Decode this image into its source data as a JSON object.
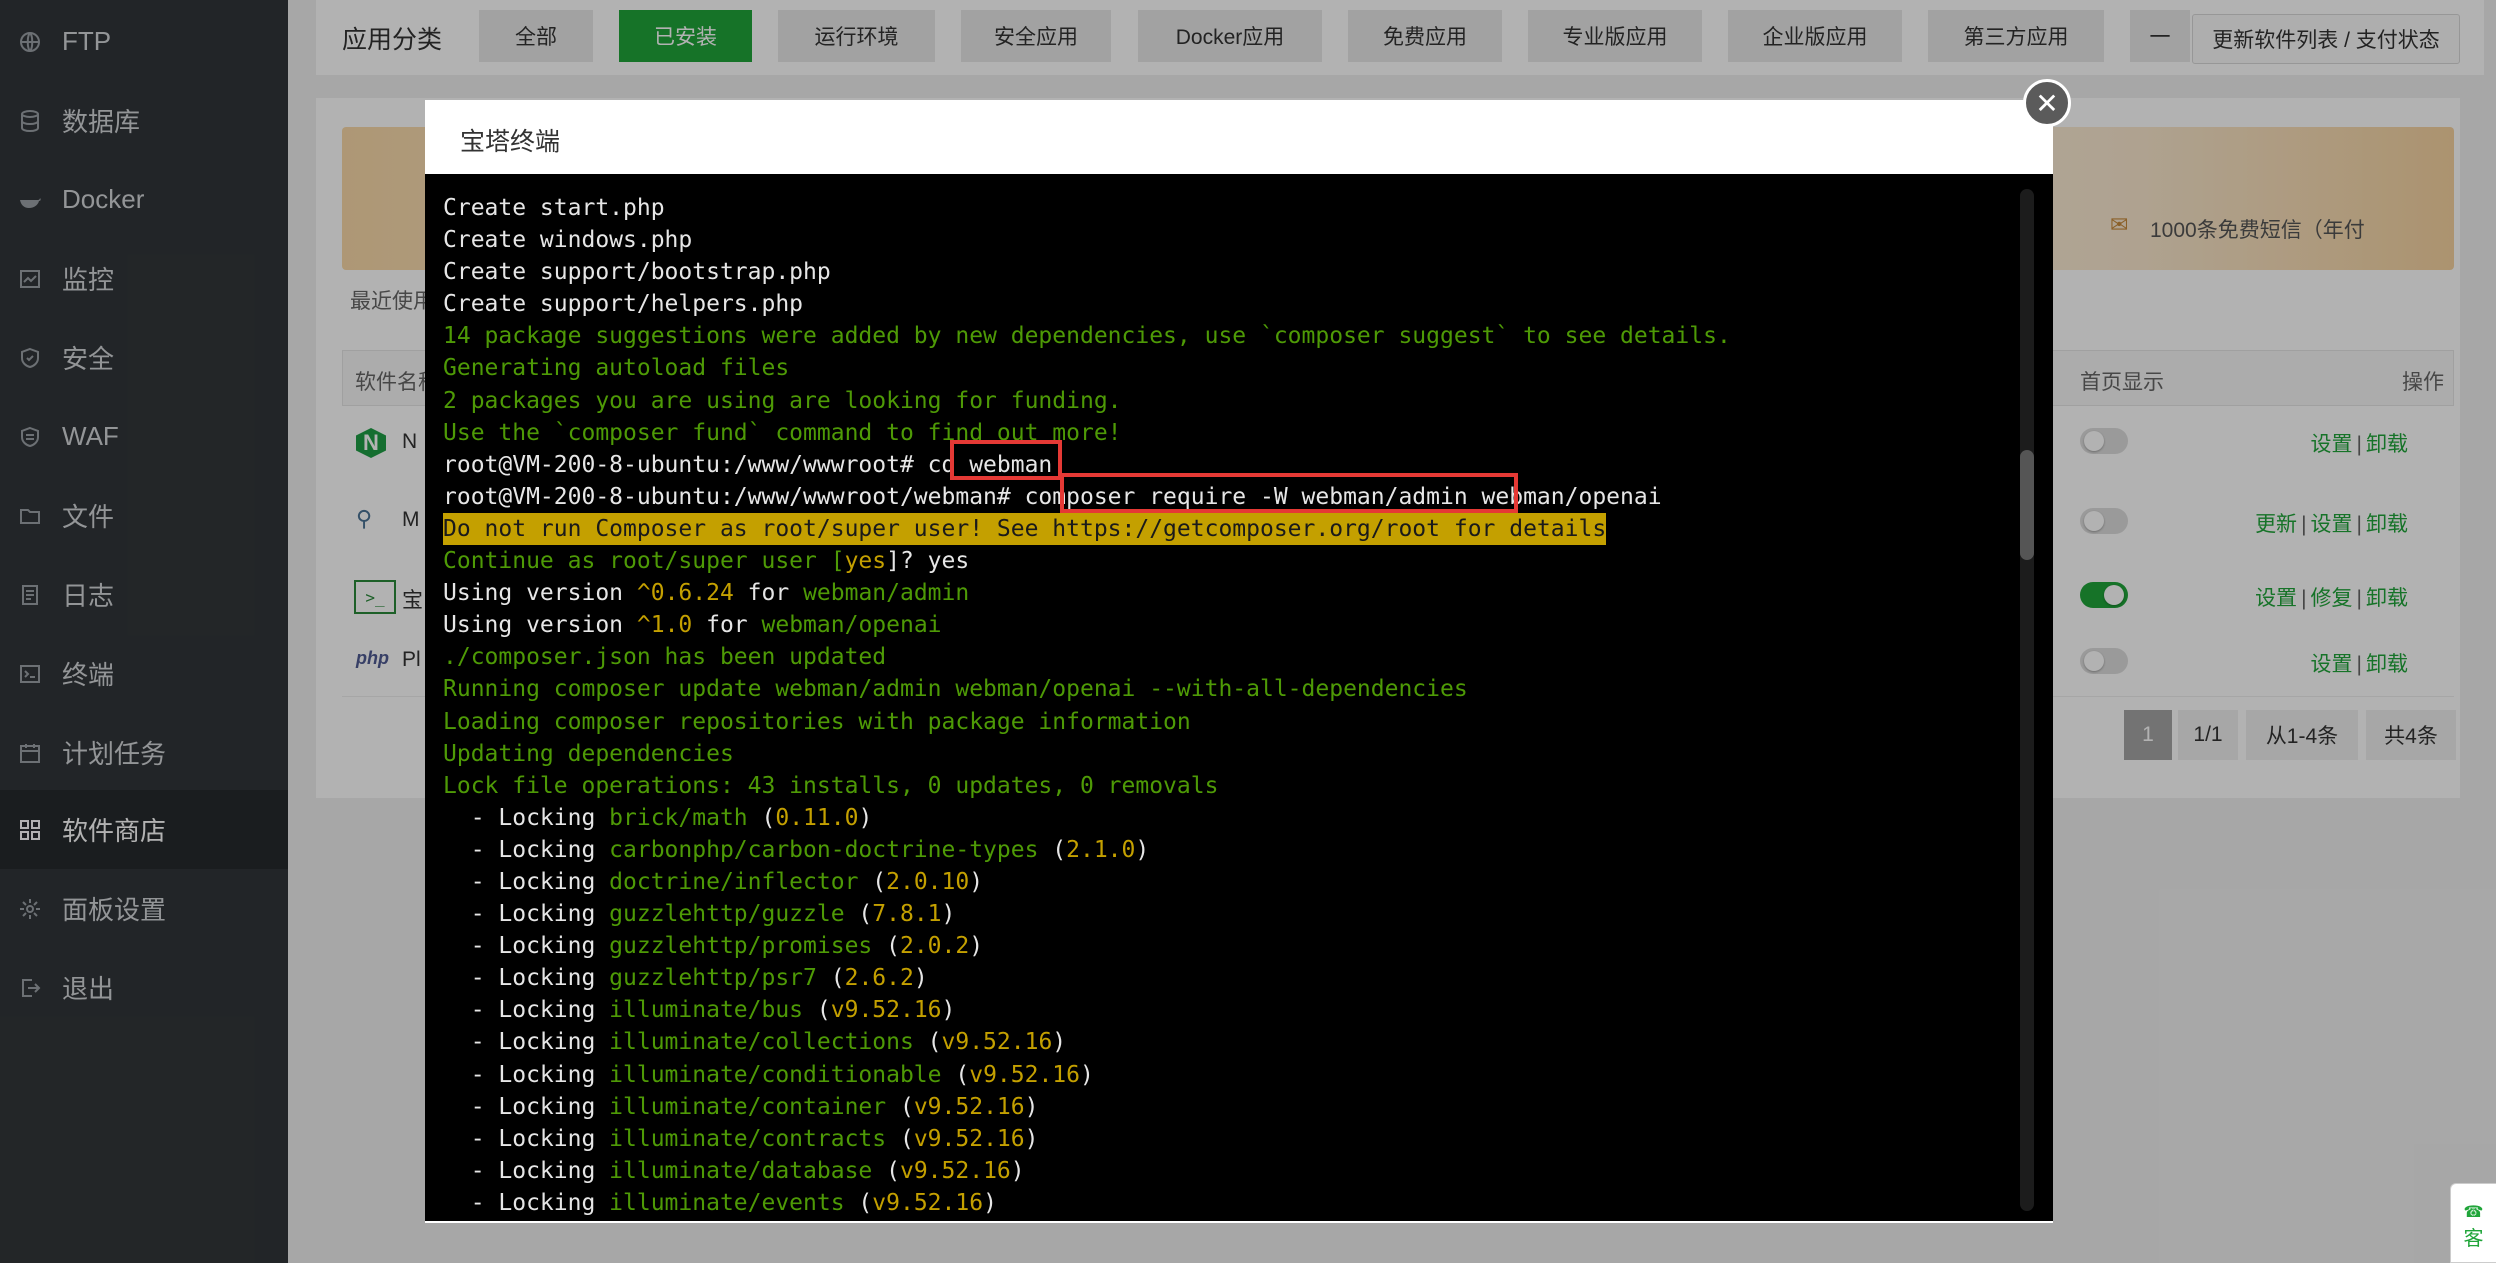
{
  "sidebar": {
    "items": [
      {
        "label": "FTP",
        "icon": "globe-icon"
      },
      {
        "label": "数据库",
        "icon": "database-icon"
      },
      {
        "label": "Docker",
        "icon": "docker-icon"
      },
      {
        "label": "监控",
        "icon": "monitor-icon"
      },
      {
        "label": "安全",
        "icon": "shield-icon"
      },
      {
        "label": "WAF",
        "icon": "waf-shield-icon"
      },
      {
        "label": "文件",
        "icon": "folder-icon"
      },
      {
        "label": "日志",
        "icon": "log-icon"
      },
      {
        "label": "终端",
        "icon": "terminal-icon"
      },
      {
        "label": "计划任务",
        "icon": "calendar-icon"
      },
      {
        "label": "软件商店",
        "icon": "apps-icon",
        "active": true
      },
      {
        "label": "面板设置",
        "icon": "gear-icon"
      },
      {
        "label": "退出",
        "icon": "logout-icon"
      }
    ]
  },
  "store": {
    "category_title": "应用分类",
    "categories": [
      "全部",
      "已安装",
      "运行环境",
      "安全应用",
      "Docker应用",
      "免费应用",
      "专业版应用",
      "企业版应用",
      "第三方应用",
      "一"
    ],
    "active_category": "已安装",
    "update_button": "更新软件列表 / 支付状态",
    "sms_promo": "1000条免费短信（年付",
    "recent_label": "最近使用",
    "table_headers": {
      "name": "软件名称",
      "home_display": "首页显示",
      "actions": "操作"
    },
    "rows": [
      {
        "icon_text": "N",
        "name_fragment": "N",
        "toggle": false,
        "actions": [
          "设置",
          "卸载"
        ]
      },
      {
        "icon_text": "⚲",
        "name_fragment": "M",
        "toggle": false,
        "actions": [
          "更新",
          "设置",
          "卸载"
        ]
      },
      {
        "icon_text": ">_",
        "name_fragment": "宝",
        "toggle": true,
        "actions": [
          "设置",
          "修复",
          "卸载"
        ]
      },
      {
        "icon_text": "php",
        "name_fragment": "Pl",
        "toggle": false,
        "actions": [
          "设置",
          "卸载"
        ]
      }
    ],
    "pager": {
      "current": "1",
      "pages": "1/1",
      "range": "从1-4条",
      "total": "共4条"
    }
  },
  "modal": {
    "title": "宝塔终端",
    "close_symbol": "✕"
  },
  "terminal": {
    "lines": [
      [
        {
          "t": "Create start.php",
          "c": "w"
        }
      ],
      [
        {
          "t": "Create windows.php",
          "c": "w"
        }
      ],
      [
        {
          "t": "Create support/bootstrap.php",
          "c": "w"
        }
      ],
      [
        {
          "t": "Create support/helpers.php",
          "c": "w"
        }
      ],
      [
        {
          "t": "14 package suggestions were added by new dependencies, use `composer suggest` to see details.",
          "c": "g"
        }
      ],
      [
        {
          "t": "Generating autoload files",
          "c": "g"
        }
      ],
      [
        {
          "t": "2 packages you are using are looking for funding.",
          "c": "g"
        }
      ],
      [
        {
          "t": "Use the `composer fund` command to find out more!",
          "c": "g"
        }
      ],
      [
        {
          "t": "root@VM-200-8-ubuntu:/www/wwwroot# cd webman",
          "c": "w"
        }
      ],
      [
        {
          "t": "root@VM-200-8-ubuntu:/www/wwwroot/webman# composer require -W webman/admin webman/openai",
          "c": "w"
        }
      ],
      [
        {
          "t": "Do not run Composer as root/super user! See https://getcomposer.org/root for details",
          "c": "warn"
        }
      ],
      [
        {
          "t": "Continue as root/super user [",
          "c": "g"
        },
        {
          "t": "yes",
          "c": "y"
        },
        {
          "t": "]? yes",
          "c": "w"
        }
      ],
      [
        {
          "t": "Using version ",
          "c": "w"
        },
        {
          "t": "^0.6.24",
          "c": "y"
        },
        {
          "t": " for ",
          "c": "w"
        },
        {
          "t": "webman/admin",
          "c": "g"
        }
      ],
      [
        {
          "t": "Using version ",
          "c": "w"
        },
        {
          "t": "^1.0",
          "c": "y"
        },
        {
          "t": " for ",
          "c": "w"
        },
        {
          "t": "webman/openai",
          "c": "g"
        }
      ],
      [
        {
          "t": "./composer.json has been updated",
          "c": "g"
        }
      ],
      [
        {
          "t": "Running composer update webman/admin webman/openai --with-all-dependencies",
          "c": "g"
        }
      ],
      [
        {
          "t": "Loading composer repositories with package information",
          "c": "g"
        }
      ],
      [
        {
          "t": "Updating dependencies",
          "c": "g"
        }
      ],
      [
        {
          "t": "Lock file operations: 43 installs, 0 updates, 0 removals",
          "c": "g"
        }
      ],
      [
        {
          "t": "  - Locking ",
          "c": "w"
        },
        {
          "t": "brick/math",
          "c": "g"
        },
        {
          "t": " (",
          "c": "w"
        },
        {
          "t": "0.11.0",
          "c": "y"
        },
        {
          "t": ")",
          "c": "w"
        }
      ],
      [
        {
          "t": "  - Locking ",
          "c": "w"
        },
        {
          "t": "carbonphp/carbon-doctrine-types",
          "c": "g"
        },
        {
          "t": " (",
          "c": "w"
        },
        {
          "t": "2.1.0",
          "c": "y"
        },
        {
          "t": ")",
          "c": "w"
        }
      ],
      [
        {
          "t": "  - Locking ",
          "c": "w"
        },
        {
          "t": "doctrine/inflector",
          "c": "g"
        },
        {
          "t": " (",
          "c": "w"
        },
        {
          "t": "2.0.10",
          "c": "y"
        },
        {
          "t": ")",
          "c": "w"
        }
      ],
      [
        {
          "t": "  - Locking ",
          "c": "w"
        },
        {
          "t": "guzzlehttp/guzzle",
          "c": "g"
        },
        {
          "t": " (",
          "c": "w"
        },
        {
          "t": "7.8.1",
          "c": "y"
        },
        {
          "t": ")",
          "c": "w"
        }
      ],
      [
        {
          "t": "  - Locking ",
          "c": "w"
        },
        {
          "t": "guzzlehttp/promises",
          "c": "g"
        },
        {
          "t": " (",
          "c": "w"
        },
        {
          "t": "2.0.2",
          "c": "y"
        },
        {
          "t": ")",
          "c": "w"
        }
      ],
      [
        {
          "t": "  - Locking ",
          "c": "w"
        },
        {
          "t": "guzzlehttp/psr7",
          "c": "g"
        },
        {
          "t": " (",
          "c": "w"
        },
        {
          "t": "2.6.2",
          "c": "y"
        },
        {
          "t": ")",
          "c": "w"
        }
      ],
      [
        {
          "t": "  - Locking ",
          "c": "w"
        },
        {
          "t": "illuminate/bus",
          "c": "g"
        },
        {
          "t": " (",
          "c": "w"
        },
        {
          "t": "v9.52.16",
          "c": "y"
        },
        {
          "t": ")",
          "c": "w"
        }
      ],
      [
        {
          "t": "  - Locking ",
          "c": "w"
        },
        {
          "t": "illuminate/collections",
          "c": "g"
        },
        {
          "t": " (",
          "c": "w"
        },
        {
          "t": "v9.52.16",
          "c": "y"
        },
        {
          "t": ")",
          "c": "w"
        }
      ],
      [
        {
          "t": "  - Locking ",
          "c": "w"
        },
        {
          "t": "illuminate/conditionable",
          "c": "g"
        },
        {
          "t": " (",
          "c": "w"
        },
        {
          "t": "v9.52.16",
          "c": "y"
        },
        {
          "t": ")",
          "c": "w"
        }
      ],
      [
        {
          "t": "  - Locking ",
          "c": "w"
        },
        {
          "t": "illuminate/container",
          "c": "g"
        },
        {
          "t": " (",
          "c": "w"
        },
        {
          "t": "v9.52.16",
          "c": "y"
        },
        {
          "t": ")",
          "c": "w"
        }
      ],
      [
        {
          "t": "  - Locking ",
          "c": "w"
        },
        {
          "t": "illuminate/contracts",
          "c": "g"
        },
        {
          "t": " (",
          "c": "w"
        },
        {
          "t": "v9.52.16",
          "c": "y"
        },
        {
          "t": ")",
          "c": "w"
        }
      ],
      [
        {
          "t": "  - Locking ",
          "c": "w"
        },
        {
          "t": "illuminate/database",
          "c": "g"
        },
        {
          "t": " (",
          "c": "w"
        },
        {
          "t": "v9.52.16",
          "c": "y"
        },
        {
          "t": ")",
          "c": "w"
        }
      ],
      [
        {
          "t": "  - Locking ",
          "c": "w"
        },
        {
          "t": "illuminate/events",
          "c": "g"
        },
        {
          "t": " (",
          "c": "w"
        },
        {
          "t": "v9.52.16",
          "c": "y"
        },
        {
          "t": ")",
          "c": "w"
        }
      ]
    ]
  },
  "chat_widget": {
    "label": "客"
  },
  "colors": {
    "accent": "#20a53a",
    "sidebar_bg": "#32363a",
    "term_green": "#4e9a06",
    "term_yellow": "#c4a000",
    "highlight_red": "#e53935"
  }
}
